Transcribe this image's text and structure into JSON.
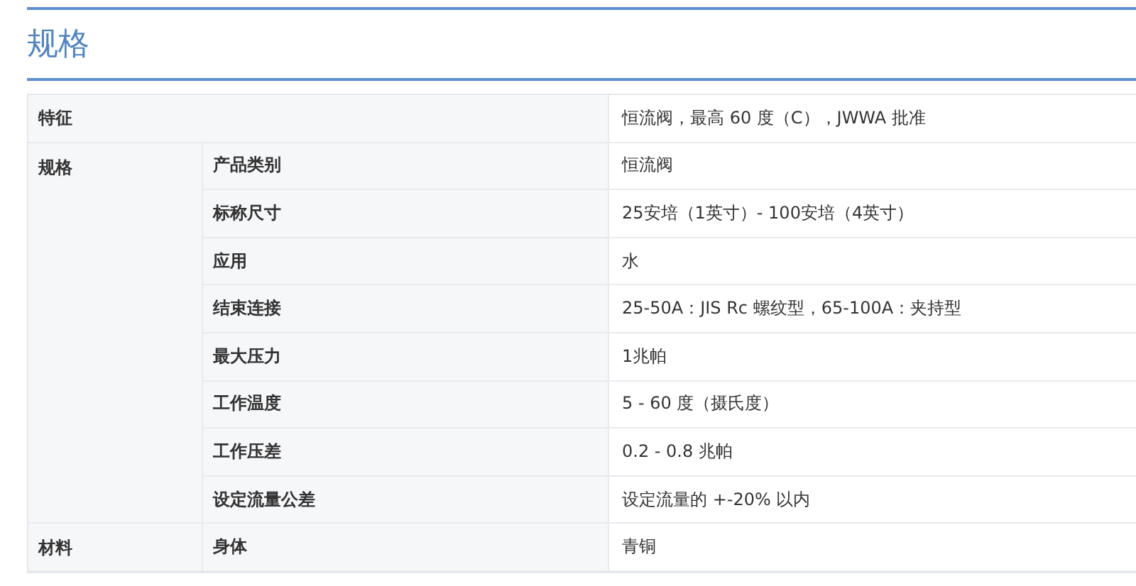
{
  "heading": "规格",
  "table": [
    {
      "kind": "full",
      "label": "特征",
      "value": "恒流阀，最高 60 度（C），JWWA 批准"
    },
    {
      "kind": "group",
      "label": "规格",
      "items": [
        {
          "name": "产品类别",
          "value": "恒流阀"
        },
        {
          "name": "标称尺寸",
          "value": "25安培（1英寸）- 100安培（4英寸）"
        },
        {
          "name": "应用",
          "value": "水"
        },
        {
          "name": "结束连接",
          "value": "25-50A：JIS Rc 螺纹型，65-100A：夹持型"
        },
        {
          "name": "最大压力",
          "value": "1兆帕"
        },
        {
          "name": "工作温度",
          "value": "5 - 60 度（摄氏度）"
        },
        {
          "name": "工作压差",
          "value": "0.2 - 0.8 兆帕"
        },
        {
          "name": "设定流量公差",
          "value": "设定流量的 +-20% 以内"
        }
      ]
    },
    {
      "kind": "group",
      "label": "材料",
      "items": [
        {
          "name": "身体",
          "value": "青铜"
        }
      ]
    }
  ]
}
